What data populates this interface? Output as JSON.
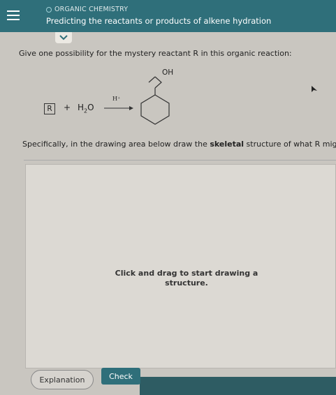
{
  "header": {
    "topic": "ORGANIC CHEMISTRY",
    "title": "Predicting the reactants or products of alkene hydration"
  },
  "question": {
    "prompt": "Give one possibility for the mystery reactant R in this organic reaction:",
    "reactant_label": "R",
    "plus": "+",
    "water_main": "H",
    "water_sub": "2",
    "water_end": "O",
    "catalyst": "H⁺",
    "product_group": "OH",
    "instruction_pre": "Specifically, in the drawing area below draw the ",
    "instruction_bold": "skeletal",
    "instruction_post": " structure of what R might b"
  },
  "drawing": {
    "hint_line1": "Click and drag to start drawing a",
    "hint_line2": "structure."
  },
  "buttons": {
    "explanation": "Explanation",
    "check": "Check"
  },
  "colors": {
    "header": "#2f6f7a",
    "accent": "#2f6f7a"
  }
}
